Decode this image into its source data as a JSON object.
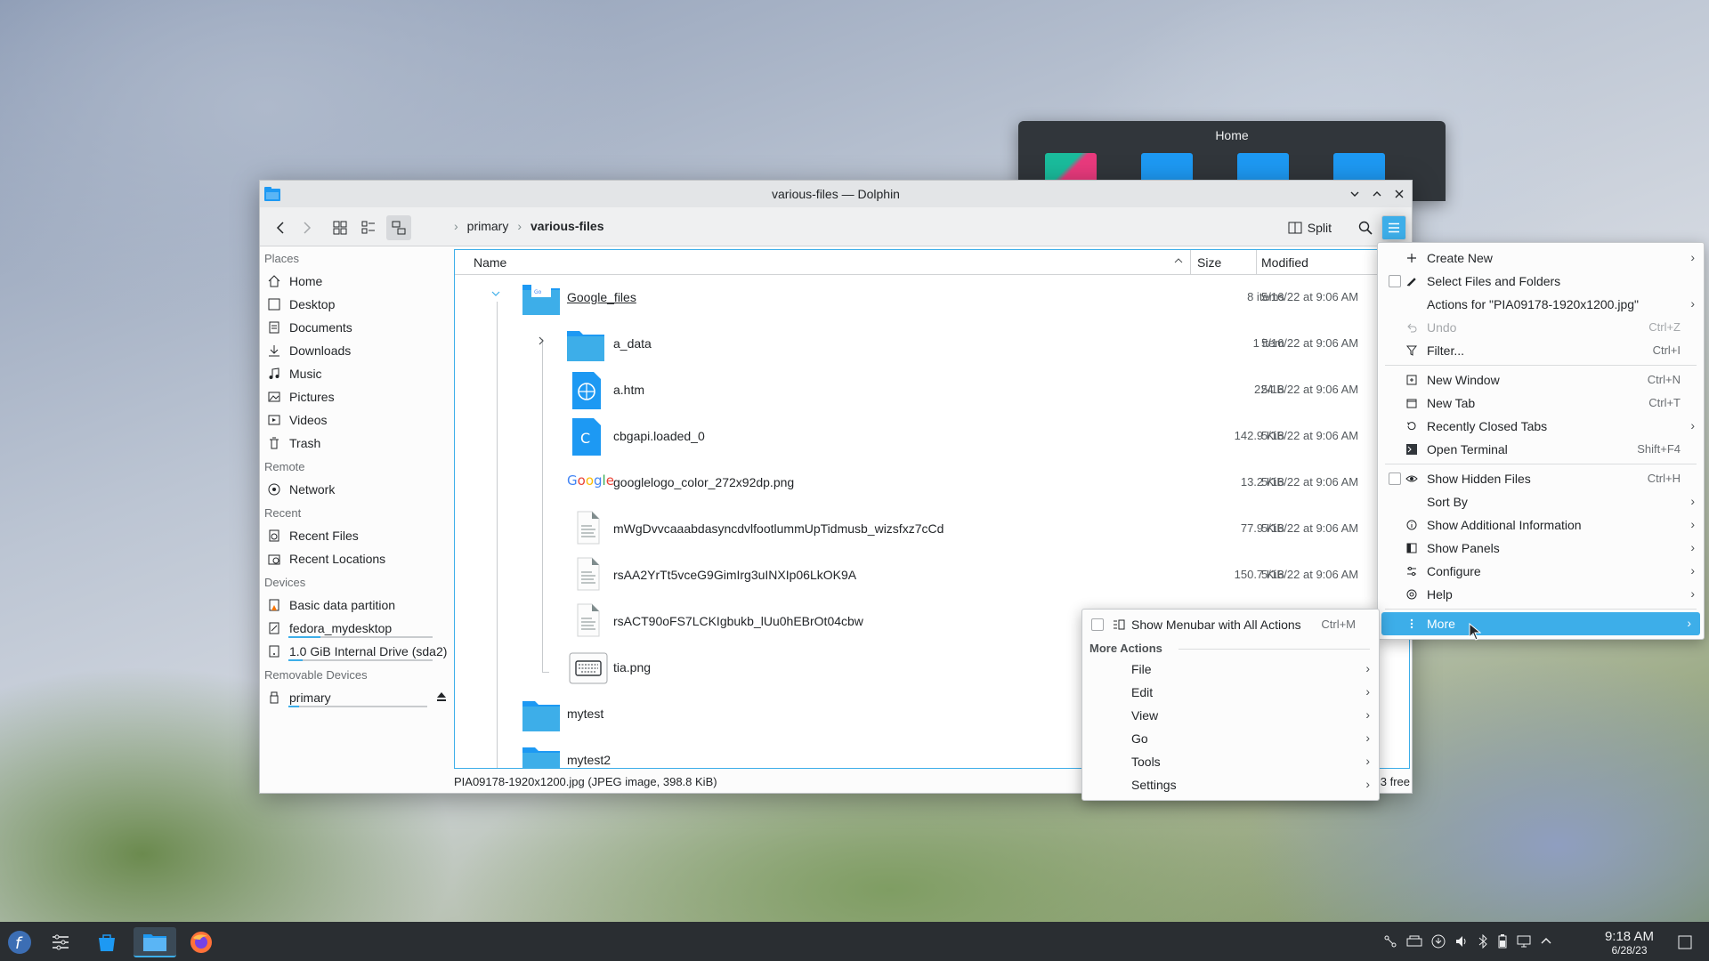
{
  "home_window": {
    "title": "Home"
  },
  "window": {
    "title": "various-files — Dolphin"
  },
  "toolbar": {
    "breadcrumbs": [
      "primary",
      "various-files"
    ],
    "split_label": "Split"
  },
  "sidebar": {
    "places_label": "Places",
    "places": [
      "Home",
      "Desktop",
      "Documents",
      "Downloads",
      "Music",
      "Pictures",
      "Videos",
      "Trash"
    ],
    "remote_label": "Remote",
    "remote": [
      "Network"
    ],
    "recent_label": "Recent",
    "recent": [
      "Recent Files",
      "Recent Locations"
    ],
    "devices_label": "Devices",
    "devices": [
      "Basic data partition",
      "fedora_mydesktop",
      "1.0 GiB Internal Drive (sda2)"
    ],
    "removable_label": "Removable Devices",
    "removable": [
      "primary"
    ]
  },
  "columns": {
    "name": "Name",
    "size": "Size",
    "modified": "Modified"
  },
  "files": [
    {
      "name": "Google_files",
      "size": "8 items",
      "modified": "5/16/22 at 9:06 AM"
    },
    {
      "name": "a_data",
      "size": "1 item",
      "modified": "5/16/22 at 9:06 AM"
    },
    {
      "name": "a.htm",
      "size": "224 B",
      "modified": "5/16/22 at 9:06 AM"
    },
    {
      "name": "cbgapi.loaded_0",
      "size": "142.9 KiB",
      "modified": "5/16/22 at 9:06 AM"
    },
    {
      "name": "googlelogo_color_272x92dp.png",
      "size": "13.2 KiB",
      "modified": "5/16/22 at 9:06 AM",
      "logo": "Google"
    },
    {
      "name": "mWgDvvcaaabdasyncdvlfootlummUpTidmusb_wizsfxz7cCd",
      "size": "77.9 KiB",
      "modified": "5/16/22 at 9:06 AM"
    },
    {
      "name": "rsAA2YrTt5vceG9GimIrg3uINXIp06LkOK9A",
      "size": "150.7 KiB",
      "modified": "5/16/22 at 9:06 AM"
    },
    {
      "name": "rsACT90oFS7LCKIgbukb_lUu0hEBrOt04cbw",
      "size": "",
      "modified": ""
    },
    {
      "name": "tia.png",
      "size": "",
      "modified": ""
    },
    {
      "name": "mytest",
      "size": "",
      "modified": ""
    },
    {
      "name": "mytest2",
      "size": "",
      "modified": ""
    }
  ],
  "status": {
    "text": "PIA09178-1920x1200.jpg (JPEG image, 398.8 KiB)",
    "free": "3 free"
  },
  "main_menu": {
    "create_new": "Create New",
    "select_files": "Select Files and Folders",
    "actions_for": "Actions for \"PIA09178-1920x1200.jpg\"",
    "undo": "Undo",
    "undo_sc": "Ctrl+Z",
    "filter": "Filter...",
    "filter_sc": "Ctrl+I",
    "new_window": "New Window",
    "new_window_sc": "Ctrl+N",
    "new_tab": "New Tab",
    "new_tab_sc": "Ctrl+T",
    "recently_closed": "Recently Closed Tabs",
    "open_terminal": "Open Terminal",
    "open_terminal_sc": "Shift+F4",
    "show_hidden": "Show Hidden Files",
    "show_hidden_sc": "Ctrl+H",
    "sort_by": "Sort By",
    "show_additional": "Show Additional Information",
    "show_panels": "Show Panels",
    "configure": "Configure",
    "help": "Help",
    "more": "More"
  },
  "more_menu": {
    "show_menubar": "Show Menubar with All Actions",
    "show_menubar_sc": "Ctrl+M",
    "section": "More Actions",
    "items": [
      "File",
      "Edit",
      "View",
      "Go",
      "Tools",
      "Settings"
    ]
  },
  "clock": {
    "time": "9:18 AM",
    "date": "6/28/23"
  },
  "colors": {
    "accent": "#3daee9",
    "folder": "#1d99f3",
    "taskbar": "#2a2e32"
  }
}
